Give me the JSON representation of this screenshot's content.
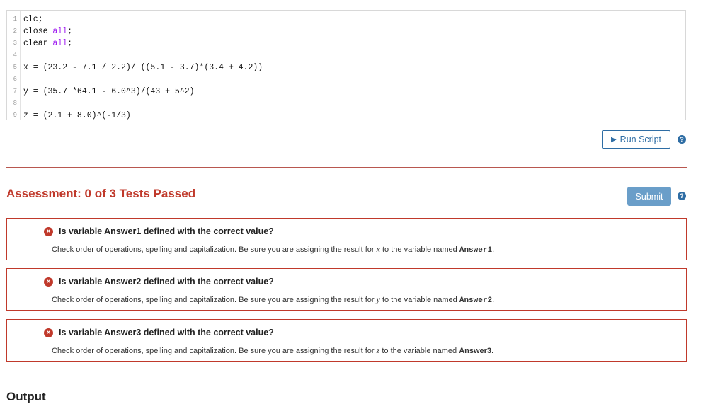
{
  "editor": {
    "lines": [
      {
        "num": "1",
        "text": "clc;"
      },
      {
        "num": "2",
        "text": "close ",
        "kw": "all",
        "tail": ";"
      },
      {
        "num": "3",
        "text": "clear ",
        "kw": "all",
        "tail": ";"
      },
      {
        "num": "4",
        "text": ""
      },
      {
        "num": "5",
        "text": "x = (23.2 - 7.1 / 2.2)/ ((5.1 - 3.7)*(3.4 + 4.2))"
      },
      {
        "num": "6",
        "text": ""
      },
      {
        "num": "7",
        "text": "y = (35.7 *64.1 - 6.0^3)/(43 + 5^2)"
      },
      {
        "num": "8",
        "text": ""
      },
      {
        "num": "9",
        "text": "z = (2.1 + 8.0)^(-1/3)"
      }
    ]
  },
  "toolbar": {
    "run_label": "Run Script",
    "run_icon": "play-icon",
    "help_glyph": "?"
  },
  "assessment": {
    "title": "Assessment: 0 of 3 Tests Passed",
    "submit_label": "Submit",
    "tests": [
      {
        "status_icon": "x-circle-icon",
        "title": "Is variable Answer1 defined with the correct value?",
        "msg_pre": "Check order of operations, spelling and capitalization.  Be sure you are assigning the result for ",
        "var_symbol": "x",
        "msg_mid": " to the variable named ",
        "var_name": "Answer1",
        "msg_end": "."
      },
      {
        "status_icon": "x-circle-icon",
        "title": "Is variable Answer2 defined with the correct value?",
        "msg_pre": "Check order of operations, spelling and capitalization.  Be sure you are assigning the result for ",
        "var_symbol": "y",
        "msg_mid": " to the variable named ",
        "var_name": "Answer2",
        "msg_end": "."
      },
      {
        "status_icon": "x-circle-icon",
        "title": "Is variable Answer3 defined with the correct value?",
        "msg_pre": "Check order of operations, spelling and capitalization.  Be sure you are assigning the result for ",
        "var_symbol": "z",
        "msg_mid": " to the variable named ",
        "var_name": "Answer3",
        "msg_end": "."
      }
    ]
  },
  "output_heading": "Output",
  "colors": {
    "accent": "#2e6da4",
    "fail": "#c0392b",
    "keyword": "#a020f0",
    "submit_bg": "#6a9ec9"
  }
}
